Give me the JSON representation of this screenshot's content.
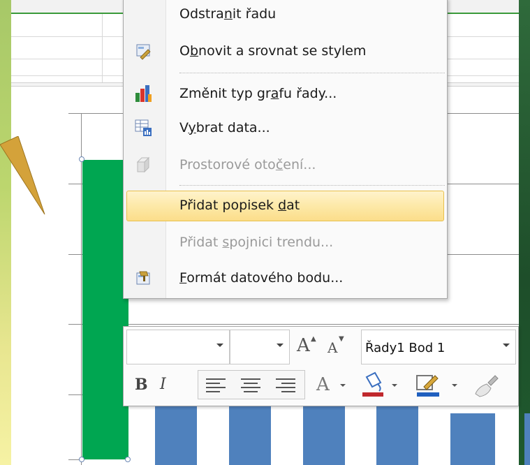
{
  "context_menu": {
    "items": [
      {
        "pre": "Odstra",
        "u": "n",
        "post": "it řadu",
        "enabled": true,
        "highlighted": false,
        "icon": null
      },
      {
        "pre": "O",
        "u": "b",
        "post": "novit a srovnat se stylem",
        "enabled": true,
        "highlighted": false,
        "icon": "reset-style-icon"
      },
      {
        "pre": "Změnit typ gr",
        "u": "a",
        "post": "fu řady...",
        "enabled": true,
        "highlighted": false,
        "icon": "chart-type-icon"
      },
      {
        "pre": "V",
        "u": "y",
        "post": "brat data...",
        "enabled": true,
        "highlighted": false,
        "icon": "select-data-icon"
      },
      {
        "pre": "Prostorové oto",
        "u": "č",
        "post": "ení...",
        "enabled": false,
        "highlighted": false,
        "icon": "3d-rotation-icon"
      },
      {
        "pre": "Přidat popisek ",
        "u": "d",
        "post": "at",
        "enabled": true,
        "highlighted": true,
        "icon": null
      },
      {
        "pre": "Přidat ",
        "u": "s",
        "post": "pojnici trendu...",
        "enabled": false,
        "highlighted": false,
        "icon": null
      },
      {
        "pre": "",
        "u": "F",
        "post": "ormát datového bodu...",
        "enabled": true,
        "highlighted": false,
        "icon": "format-data-point-icon"
      }
    ]
  },
  "mini_toolbar": {
    "font_name_value": "",
    "font_size_value": "",
    "grow_font_glyph": "A",
    "shrink_font_glyph": "A",
    "chart_element_value": "Řady1 Bod 1",
    "bold_glyph": "B",
    "italic_glyph": "I",
    "font_color_glyph": "A",
    "fill_color": "#c0282d",
    "line_color": "#1f5fbf"
  },
  "chart_data": {
    "type": "bar",
    "visible_portion_only": true,
    "series_colors": {
      "selected_point": "#00a651",
      "others": "#4f81bd"
    },
    "selected_point": "Řady1 Bod 1",
    "grid": true
  },
  "colors": {
    "highlight": "#fde9a8",
    "disabled_text": "#9a9a9a",
    "callout_arrow": "#d4a23a"
  }
}
